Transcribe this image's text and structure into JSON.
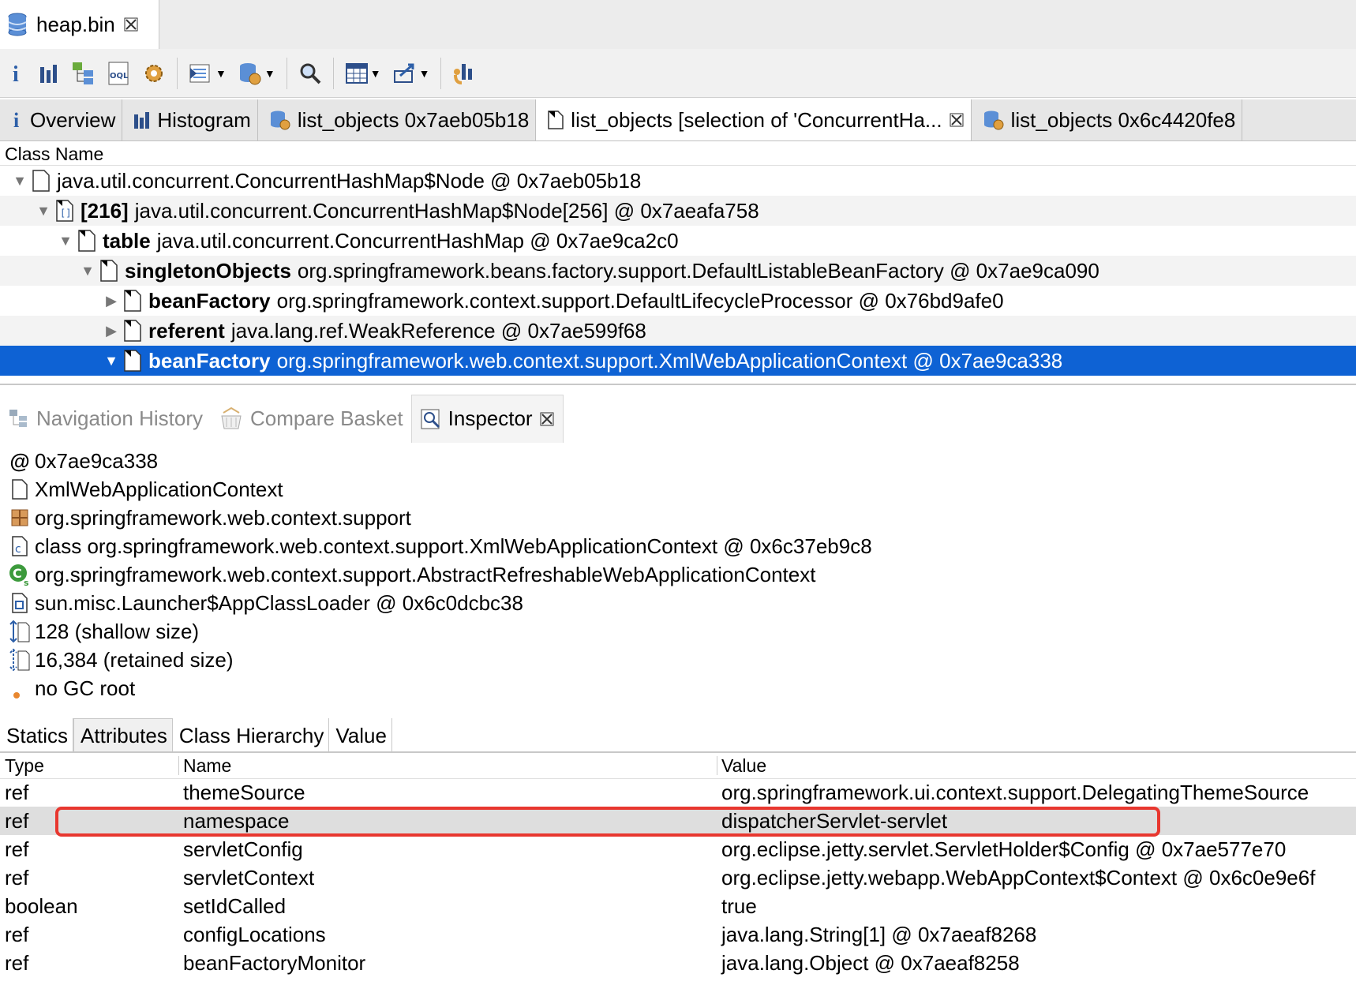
{
  "editor_tab": {
    "title": "heap.bin"
  },
  "toolbar": {
    "icons": [
      "info-icon",
      "histogram-icon",
      "dominator-tree-icon",
      "oql-icon",
      "gear-icon",
      "thread-icon",
      "query-browser-icon",
      "search-icon",
      "table-icon",
      "export-icon",
      "leak-icon"
    ]
  },
  "result_tabs": [
    {
      "label": "Overview"
    },
    {
      "label": "Histogram"
    },
    {
      "label": "list_objects 0x7aeb05b18"
    },
    {
      "label": "list_objects [selection of 'ConcurrentHa..."
    },
    {
      "label": "list_objects 0x6c4420fe8"
    }
  ],
  "tree": {
    "header": "Class Name",
    "rows": [
      {
        "bold": "",
        "text": "java.util.concurrent.ConcurrentHashMap$Node @ 0x7aeb05b18"
      },
      {
        "bold": "[216]",
        "text": "java.util.concurrent.ConcurrentHashMap$Node[256] @ 0x7aeafa758"
      },
      {
        "bold": "table",
        "text": "java.util.concurrent.ConcurrentHashMap @ 0x7ae9ca2c0"
      },
      {
        "bold": "singletonObjects",
        "text": "org.springframework.beans.factory.support.DefaultListableBeanFactory @ 0x7ae9ca090"
      },
      {
        "bold": "beanFactory",
        "text": "org.springframework.context.support.DefaultLifecycleProcessor @ 0x76bd9afe0"
      },
      {
        "bold": "referent",
        "text": "java.lang.ref.WeakReference @ 0x7ae599f68"
      },
      {
        "bold": "beanFactory",
        "text": "org.springframework.web.context.support.XmlWebApplicationContext @ 0x7ae9ca338"
      }
    ]
  },
  "view_tabs": [
    {
      "label": "Navigation History"
    },
    {
      "label": "Compare Basket"
    },
    {
      "label": "Inspector"
    }
  ],
  "inspector": {
    "address": "0x7ae9ca338",
    "class_name": "XmlWebApplicationContext",
    "package": "org.springframework.web.context.support",
    "class_ref": "class org.springframework.web.context.support.XmlWebApplicationContext @ 0x6c37eb9c8",
    "superclass": "org.springframework.web.context.support.AbstractRefreshableWebApplicationContext",
    "class_loader": "sun.misc.Launcher$AppClassLoader @ 0x6c0dcbc38",
    "shallow_size": "128 (shallow size)",
    "retained_size": "16,384 (retained size)",
    "gc_root": "no GC root"
  },
  "sub_tabs": [
    {
      "label": "Statics"
    },
    {
      "label": "Attributes"
    },
    {
      "label": "Class Hierarchy"
    },
    {
      "label": "Value"
    }
  ],
  "attributes": {
    "columns": [
      "Type",
      "Name",
      "Value"
    ],
    "rows": [
      {
        "type": "ref",
        "name": "themeSource",
        "value": "org.springframework.ui.context.support.DelegatingThemeSource"
      },
      {
        "type": "ref",
        "name": "namespace",
        "value": "dispatcherServlet-servlet"
      },
      {
        "type": "ref",
        "name": "servletConfig",
        "value": "org.eclipse.jetty.servlet.ServletHolder$Config @ 0x7ae577e70"
      },
      {
        "type": "ref",
        "name": "servletContext",
        "value": "org.eclipse.jetty.webapp.WebAppContext$Context @ 0x6c0e9e6f"
      },
      {
        "type": "boolean",
        "name": "setIdCalled",
        "value": "true"
      },
      {
        "type": "ref",
        "name": "configLocations",
        "value": "java.lang.String[1] @ 0x7aeaf8268"
      },
      {
        "type": "ref",
        "name": "beanFactoryMonitor",
        "value": "java.lang.Object @ 0x7aeaf8258"
      }
    ]
  },
  "colors": {
    "selection": "#0e62d4",
    "highlight_box": "#e8372f"
  }
}
